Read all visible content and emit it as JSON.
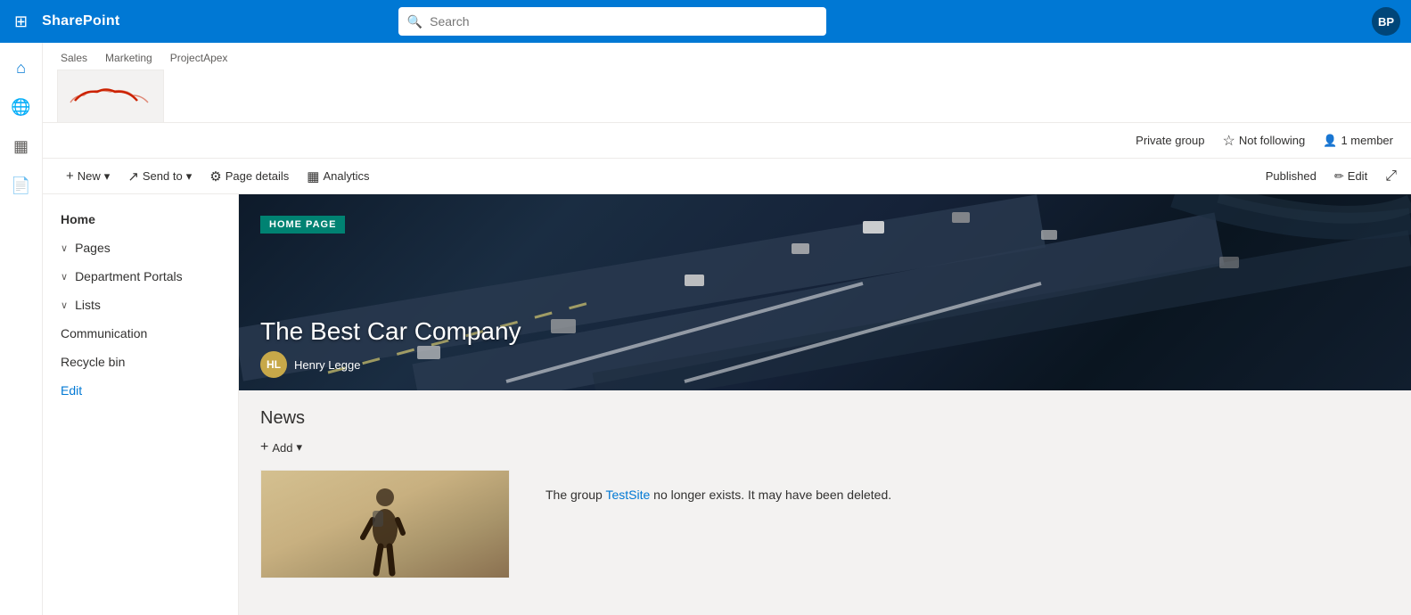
{
  "topbar": {
    "logo": "SharePoint",
    "search_placeholder": "Search",
    "avatar_initials": "BP"
  },
  "rail_icons": [
    {
      "name": "home-icon",
      "symbol": "⌂"
    },
    {
      "name": "globe-icon",
      "symbol": "🌐"
    },
    {
      "name": "cards-icon",
      "symbol": "⊞"
    },
    {
      "name": "document-icon",
      "symbol": "📄"
    }
  ],
  "site_tabs": [
    {
      "label": "Sales"
    },
    {
      "label": "Marketing"
    },
    {
      "label": "ProjectApex"
    }
  ],
  "status_bar": {
    "private_group": "Private group",
    "not_following": "Not following",
    "members": "1 member"
  },
  "toolbar": {
    "new_label": "New",
    "send_to_label": "Send to",
    "page_details_label": "Page details",
    "analytics_label": "Analytics",
    "published_label": "Published",
    "edit_label": "Edit"
  },
  "sidebar": {
    "home": "Home",
    "pages": "Pages",
    "department_portals": "Department Portals",
    "lists": "Lists",
    "communication": "Communication",
    "recycle_bin": "Recycle bin",
    "edit": "Edit"
  },
  "hero": {
    "badge": "HOME PAGE",
    "title": "The Best Car Company",
    "author_initials": "HL",
    "author_name": "Henry Legge"
  },
  "news": {
    "title": "News",
    "add_label": "Add",
    "group_message_pre": "The group ",
    "group_link": "TestSite",
    "group_message_post": " no longer exists. It may have been deleted."
  }
}
